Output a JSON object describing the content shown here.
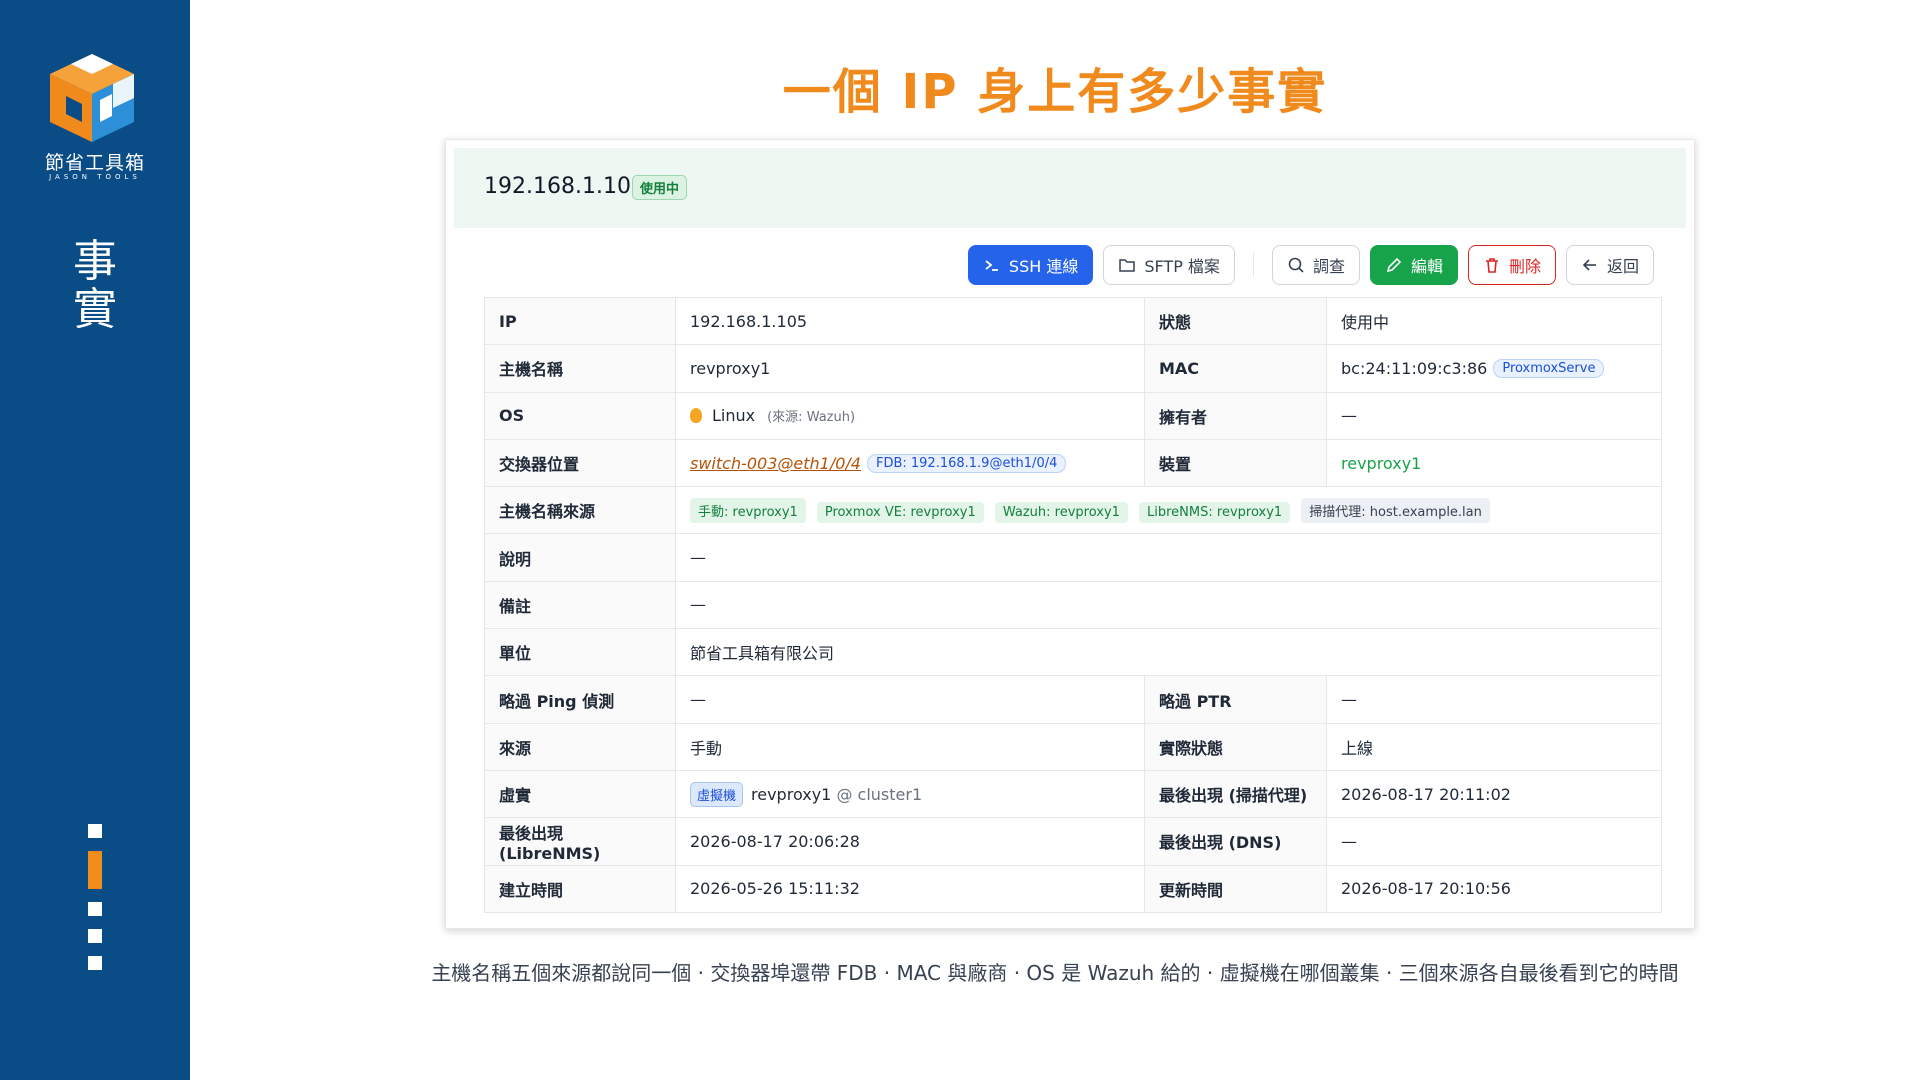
{
  "sidebar": {
    "logo_text": "節省工具箱",
    "logo_sub": "JASON TOOLS",
    "section_title_1": "事",
    "section_title_2": "實"
  },
  "title": "一個 IP 身上有多少事實",
  "card": {
    "ip": "192.168.1.105",
    "status_badge": "使用中",
    "toolbar": {
      "ssh": "SSH 連線",
      "sftp": "SFTP 檔案",
      "investigate": "調查",
      "edit": "編輯",
      "delete": "刪除",
      "back": "返回"
    },
    "rows": {
      "ip_label": "IP",
      "ip_value": "192.168.1.105",
      "status_label": "狀態",
      "status_value": "使用中",
      "hostname_label": "主機名稱",
      "hostname_value": "revproxy1",
      "mac_label": "MAC",
      "mac_value": "bc:24:11:09:c3:86",
      "mac_vendor": "ProxmoxServe",
      "os_label": "OS",
      "os_value": "Linux",
      "os_source": "(來源: Wazuh)",
      "owner_label": "擁有者",
      "owner_value": "—",
      "switch_label": "交換器位置",
      "switch_value": "switch-003@eth1/0/4",
      "fdb_tag": "FDB: 192.168.1.9@eth1/0/4",
      "device_label": "裝置",
      "device_value": "revproxy1",
      "hostsrc_label": "主機名稱來源",
      "hostsrc_tags": [
        "手動: revproxy1",
        "Proxmox VE: revproxy1",
        "Wazuh: revproxy1",
        "LibreNMS: revproxy1"
      ],
      "hostsrc_scan": "掃描代理: host.example.lan",
      "desc_label": "說明",
      "desc_value": "—",
      "note_label": "備註",
      "note_value": "—",
      "unit_label": "單位",
      "unit_value": "節省工具箱有限公司",
      "skip_ping_label": "略過 Ping 偵測",
      "skip_ping_value": "—",
      "skip_ptr_label": "略過 PTR",
      "skip_ptr_value": "—",
      "source_label": "來源",
      "source_value": "手動",
      "actual_status_label": "實際狀態",
      "actual_status_value": "上線",
      "virtual_label": "虛實",
      "vm_tag": "虛擬機",
      "vm_name": "revproxy1",
      "vm_cluster": "@ cluster1",
      "last_scan_label": "最後出現 (掃描代理)",
      "last_scan_value": "2026-08-17 20:11:02",
      "last_librenms_label": "最後出現 (LibreNMS)",
      "last_librenms_value": "2026-08-17 20:06:28",
      "last_dns_label": "最後出現 (DNS)",
      "last_dns_value": "—",
      "created_label": "建立時間",
      "created_value": "2026-05-26 15:11:32",
      "updated_label": "更新時間",
      "updated_value": "2026-08-17 20:10:56"
    }
  },
  "caption": "主機名稱五個來源都說同一個 · 交換器埠還帶 FDB · MAC 與廠商 · OS 是 Wazuh 給的 · 虛擬機在哪個叢集 · 三個來源各自最後看到它的時間",
  "colors": {
    "sidebar": "#0a4c86",
    "accent_orange": "#f08a1c",
    "primary_blue": "#2563eb",
    "success_green": "#16a34a",
    "danger_red": "#dc2626"
  }
}
